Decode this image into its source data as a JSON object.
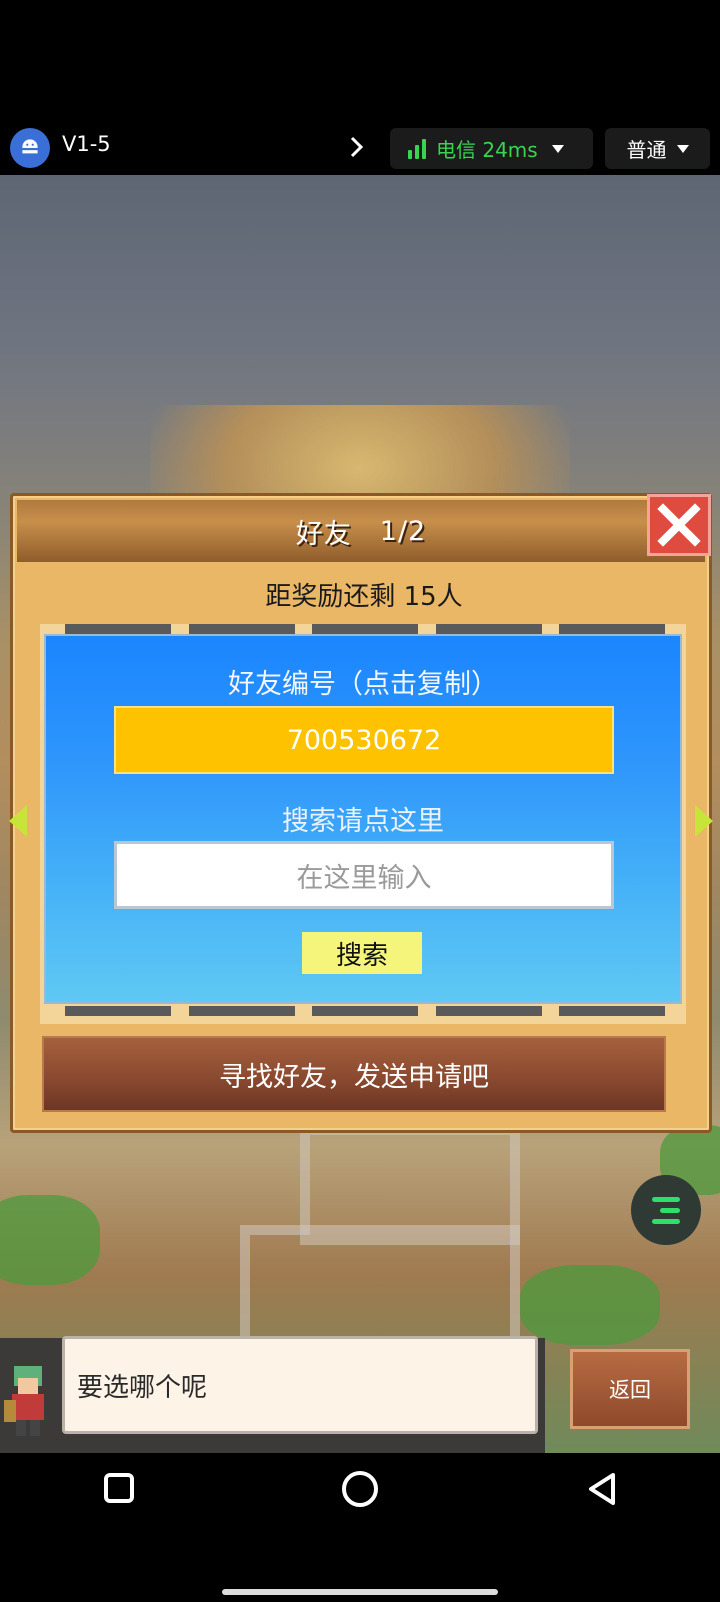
{
  "topbar": {
    "app_icon": "android-icon",
    "version": "V1-5",
    "network_label": "电信 24ms",
    "mode_label": "普通"
  },
  "dialog": {
    "title": "好友",
    "page": "1/2",
    "reward_text": "距奖励还剩 15人",
    "friend_id_label": "好友编号（点击复制）",
    "friend_id": "700530672",
    "search_label": "搜索请点这里",
    "search_placeholder": "在这里输入",
    "search_button": "搜索",
    "find_button": "寻找好友，发送申请吧"
  },
  "chat": {
    "message": "要选哪个呢",
    "back_button": "返回"
  },
  "colors": {
    "accent_green": "#39d353",
    "id_box": "#ffc200",
    "close_red": "#e04b3f"
  }
}
